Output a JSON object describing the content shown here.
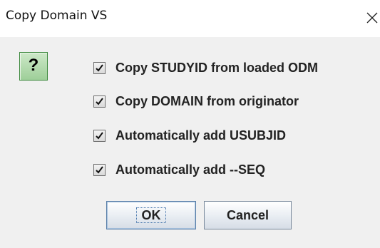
{
  "dialog": {
    "title": "Copy Domain VS",
    "close_icon": "close-icon",
    "question_icon": {
      "name": "question-icon",
      "glyph": "?",
      "color": "#aed8a8"
    },
    "options": [
      {
        "label": "Copy STUDYID from loaded ODM",
        "checked": true
      },
      {
        "label": "Copy DOMAIN from originator",
        "checked": true
      },
      {
        "label": "Automatically add USUBJID",
        "checked": true
      },
      {
        "label": "Automatically add --SEQ",
        "checked": true
      }
    ],
    "buttons": {
      "ok_label": "OK",
      "cancel_label": "Cancel"
    },
    "background_color": "#f0f0f0",
    "titlebar_color": "#ffffff"
  }
}
